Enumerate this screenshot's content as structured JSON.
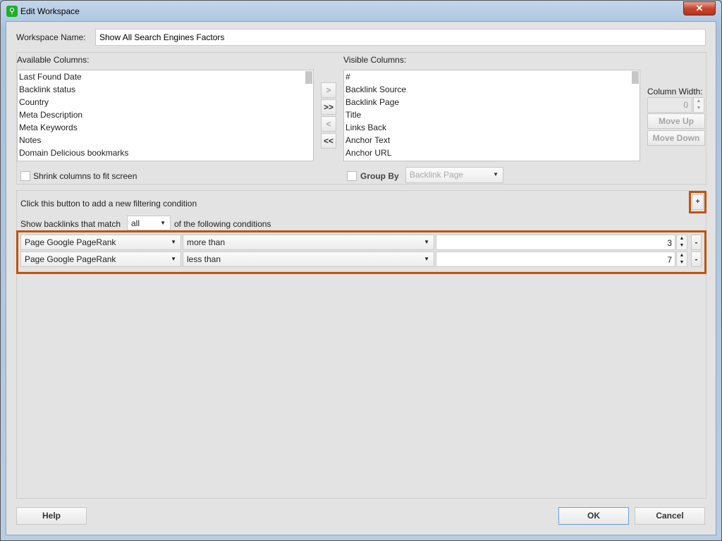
{
  "window": {
    "title": "Edit Workspace",
    "close_label": "✕"
  },
  "workspace_name": {
    "label": "Workspace Name:",
    "value": "Show All Search Engines Factors"
  },
  "available": {
    "label": "Available Columns:",
    "items": [
      "Last Found Date",
      "Backlink status",
      "Country",
      "Meta Description",
      "Meta Keywords",
      "Notes",
      "Domain Delicious bookmarks"
    ]
  },
  "visible": {
    "label": "Visible Columns:",
    "items": [
      "#",
      "Backlink Source",
      "Backlink Page",
      "Title",
      "Links Back",
      "Anchor Text",
      "Anchor URL"
    ]
  },
  "move_buttons": {
    "add": ">",
    "add_all": ">>",
    "remove": "<",
    "remove_all": "<<"
  },
  "column_width": {
    "label": "Column Width:",
    "value": "0"
  },
  "move_up": "Move Up",
  "move_down": "Move Down",
  "shrink_label": "Shrink columns to fit screen",
  "group_by": {
    "label": "Group By",
    "value": "Backlink Page"
  },
  "filter": {
    "hint": "Click this button to add a new filtering condition",
    "add_label": "+",
    "match_prefix": "Show backlinks that match",
    "match_value": "all",
    "match_suffix": "of the following conditions",
    "conditions": [
      {
        "field": "Page Google PageRank",
        "operator": "more than",
        "value": "3"
      },
      {
        "field": "Page Google PageRank",
        "operator": "less than",
        "value": "7"
      }
    ],
    "remove_label": "-"
  },
  "footer": {
    "help": "Help",
    "ok": "OK",
    "cancel": "Cancel"
  },
  "colors": {
    "highlight": "#c0530f"
  }
}
